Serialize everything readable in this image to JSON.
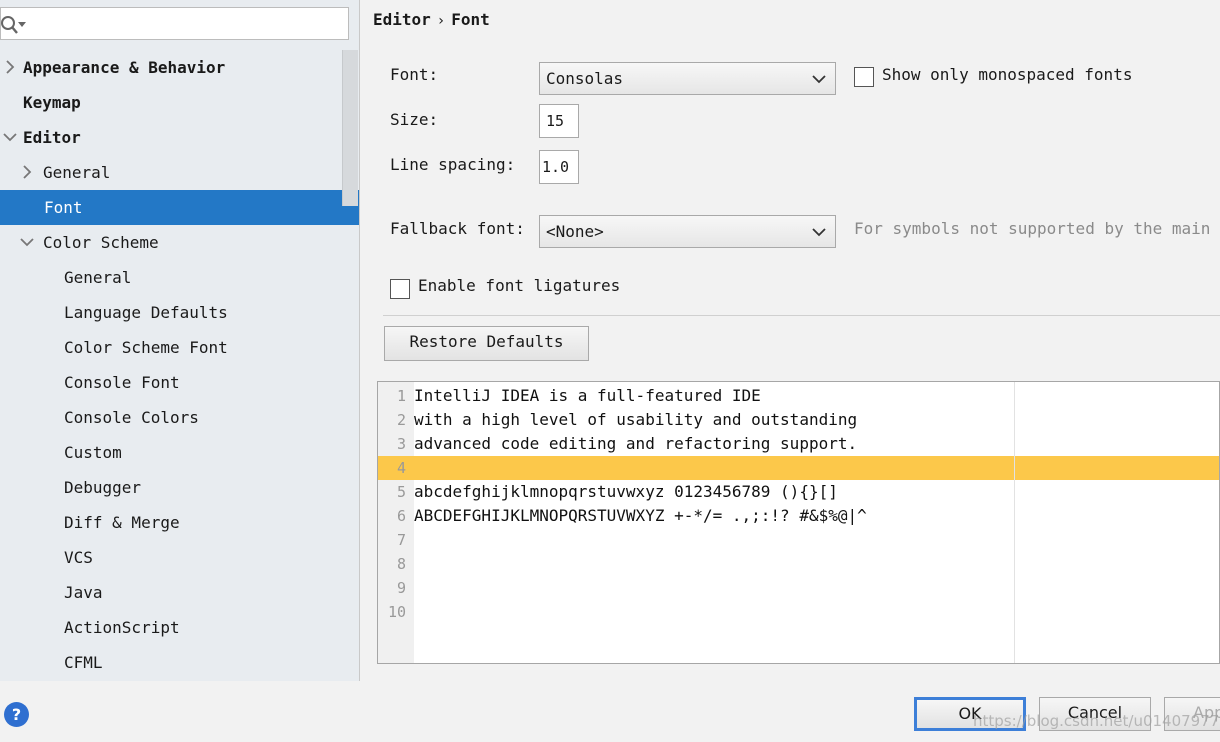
{
  "sidebar": {
    "search": {
      "value": "",
      "placeholder": ""
    },
    "items": [
      {
        "label": "Appearance & Behavior"
      },
      {
        "label": "Keymap"
      },
      {
        "label": "Editor"
      },
      {
        "label": "General"
      },
      {
        "label": "Font"
      },
      {
        "label": "Color Scheme"
      },
      {
        "label": "General"
      },
      {
        "label": "Language Defaults"
      },
      {
        "label": "Color Scheme Font"
      },
      {
        "label": "Console Font"
      },
      {
        "label": "Console Colors"
      },
      {
        "label": "Custom"
      },
      {
        "label": "Debugger"
      },
      {
        "label": "Diff & Merge"
      },
      {
        "label": "VCS"
      },
      {
        "label": "Java"
      },
      {
        "label": "ActionScript"
      },
      {
        "label": "CFML"
      }
    ]
  },
  "breadcrumb": {
    "section": "Editor",
    "separator": "›",
    "page": "Font"
  },
  "form": {
    "font_label": "Font:",
    "font_value": "Consolas",
    "mono_only_label": "Show only monospaced fonts",
    "mono_only_checked": false,
    "size_label": "Size:",
    "size_value": "15",
    "line_spacing_label": "Line spacing:",
    "line_spacing_value": "1.0",
    "fallback_label": "Fallback font:",
    "fallback_value": "<None>",
    "fallback_hint": "For symbols not supported by the main",
    "ligatures_label": "Enable font ligatures",
    "ligatures_checked": false,
    "restore_label": "Restore Defaults"
  },
  "preview": {
    "lines": [
      {
        "num": "1",
        "text": "IntelliJ IDEA is a full-featured IDE"
      },
      {
        "num": "2",
        "text": "with a high level of usability and outstanding"
      },
      {
        "num": "3",
        "text": "advanced code editing and refactoring support."
      },
      {
        "num": "4",
        "text": ""
      },
      {
        "num": "5",
        "text": "abcdefghijklmnopqrstuvwxyz 0123456789 (){}[]"
      },
      {
        "num": "6",
        "text": "ABCDEFGHIJKLMNOPQRSTUVWXYZ +-*/= .,;:!? #&$%@|^"
      },
      {
        "num": "7",
        "text": ""
      },
      {
        "num": "8",
        "text": ""
      },
      {
        "num": "9",
        "text": ""
      },
      {
        "num": "10",
        "text": ""
      }
    ],
    "current_line_color": "#fcc84a"
  },
  "footer": {
    "help_icon": "?",
    "ok_label": "OK",
    "cancel_label": "Cancel",
    "apply_label": "Apply",
    "watermark": "https://blog.csdn.net/u014079773"
  },
  "colors": {
    "selection": "#2378c6",
    "focus_border": "#3d7fd8"
  }
}
